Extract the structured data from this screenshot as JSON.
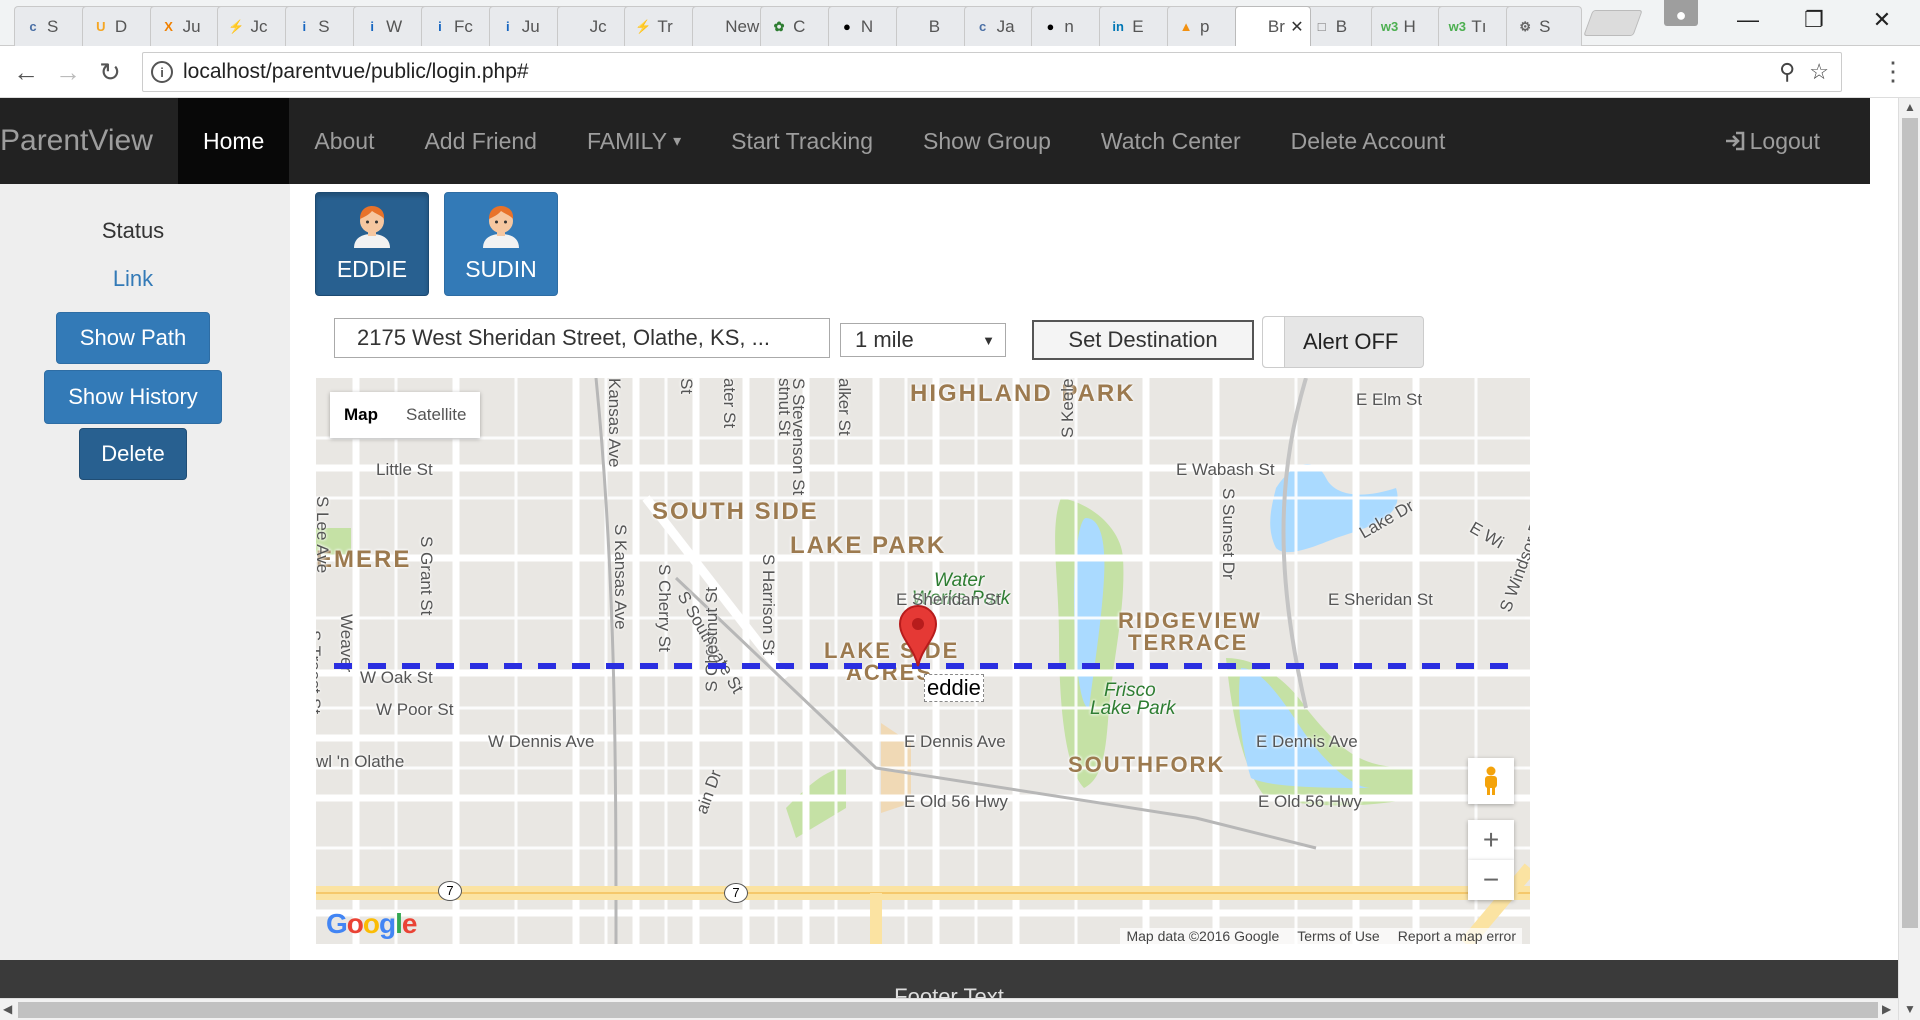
{
  "browser": {
    "tabs": [
      {
        "label": "S",
        "favicon": "c-icon",
        "color": "#4a6fa5"
      },
      {
        "label": "D",
        "favicon": "u-icon",
        "color": "#f5a623"
      },
      {
        "label": "Ju",
        "favicon": "x-icon",
        "color": "#f08000"
      },
      {
        "label": "Jc",
        "favicon": "bulb-icon",
        "color": "#1e88e5"
      },
      {
        "label": "S",
        "favicon": "info-icon",
        "color": "#1565c0"
      },
      {
        "label": "W",
        "favicon": "info-icon",
        "color": "#1565c0"
      },
      {
        "label": "Fc",
        "favicon": "info-icon",
        "color": "#1565c0"
      },
      {
        "label": "Ju",
        "favicon": "info-icon",
        "color": "#1565c0"
      },
      {
        "label": "Jc",
        "favicon": "blank-icon",
        "color": "#999999"
      },
      {
        "label": "Tr",
        "favicon": "bulb-icon",
        "color": "#1e88e5"
      },
      {
        "label": "New",
        "favicon": "none",
        "color": "#999999"
      },
      {
        "label": "C",
        "favicon": "leaf-icon",
        "color": "#2e7d32"
      },
      {
        "label": "N",
        "favicon": "github-icon",
        "color": "#000000"
      },
      {
        "label": "B",
        "favicon": "none",
        "color": "#999999"
      },
      {
        "label": "Ja",
        "favicon": "c-icon",
        "color": "#4a6fa5"
      },
      {
        "label": "n",
        "favicon": "github-icon",
        "color": "#000000"
      },
      {
        "label": "E",
        "favicon": "linkedin-icon",
        "color": "#0077b5"
      },
      {
        "label": "p",
        "favicon": "pma-icon",
        "color": "#f29111"
      },
      {
        "label": "Br",
        "favicon": "none",
        "color": "#999999",
        "active": true
      },
      {
        "label": "B",
        "favicon": "doc-icon",
        "color": "#777777"
      },
      {
        "label": "H",
        "favicon": "w3-icon",
        "color": "#4caf50"
      },
      {
        "label": "Tı",
        "favicon": "w3-icon",
        "color": "#4caf50"
      },
      {
        "label": "S",
        "favicon": "gear-icon",
        "color": "#666666"
      }
    ],
    "url": "localhost/parentvue/public/login.php#"
  },
  "navbar": {
    "brand": "ParentView",
    "items": [
      {
        "label": "Home",
        "active": true
      },
      {
        "label": "About"
      },
      {
        "label": "Add Friend"
      },
      {
        "label": "FAMILY",
        "dropdown": true
      },
      {
        "label": "Start Tracking"
      },
      {
        "label": "Show Group"
      },
      {
        "label": "Watch Center"
      },
      {
        "label": "Delete Account"
      }
    ],
    "logout": "Logout"
  },
  "sidebar": {
    "status": "Status",
    "link": "Link",
    "show_path": "Show Path",
    "show_history": "Show History",
    "delete": "Delete"
  },
  "members": [
    {
      "name": "EDDIE",
      "active": true
    },
    {
      "name": "SUDIN",
      "active": false
    }
  ],
  "controls": {
    "address": "2175 West Sheridan Street, Olathe, KS, ...",
    "radius": "1 mile",
    "set_destination": "Set Destination",
    "alert": "Alert OFF"
  },
  "map": {
    "type_map": "Map",
    "type_satellite": "Satellite",
    "marker_label": "eddie",
    "attribution": [
      "Map data ©2016 Google",
      "Terms of Use",
      "Report a map error"
    ],
    "logo": "Google",
    "path_color": "#2a2ee0",
    "areas": [
      "HIGHLAND PARK",
      "SOUTH SIDE",
      "LAKE PARK",
      "EMERE",
      "RIDGEVIEW",
      "TERRACE",
      "LAKE SIDE",
      "ACRES",
      "SOUTHFORK"
    ],
    "parks": [
      "Water",
      "Works Park",
      "Frisco",
      "Lake Park"
    ],
    "streets": [
      "E Elm St",
      "E Wabash St",
      "Little St",
      "S Lee Ave",
      "S Grant St",
      "S Kansas Ave",
      "S Cherry St",
      "S Southgate St",
      "S Harrison St",
      "E Sheridan St",
      "E Sheridan St",
      "S Keeler St",
      "Lake Dr",
      "S Sunset Dr",
      "E Wi",
      "S Windsor Rd",
      "S Troost St",
      "Weaver",
      "W Oak St",
      "W Poor St",
      "W Dennis Ave",
      "E Dennis Ave",
      "E Dennis Ave",
      "S Chestnut St",
      "E Old 56 Hwy",
      "E Old 56 Hwy",
      "S Stevenson St",
      "Kansas Ave",
      "St",
      "stnut St",
      "ater St",
      "alker St",
      "ain Dr",
      "wl 'n Olathe"
    ],
    "route_badge": "7"
  },
  "footer": {
    "text": "Footer Text"
  }
}
